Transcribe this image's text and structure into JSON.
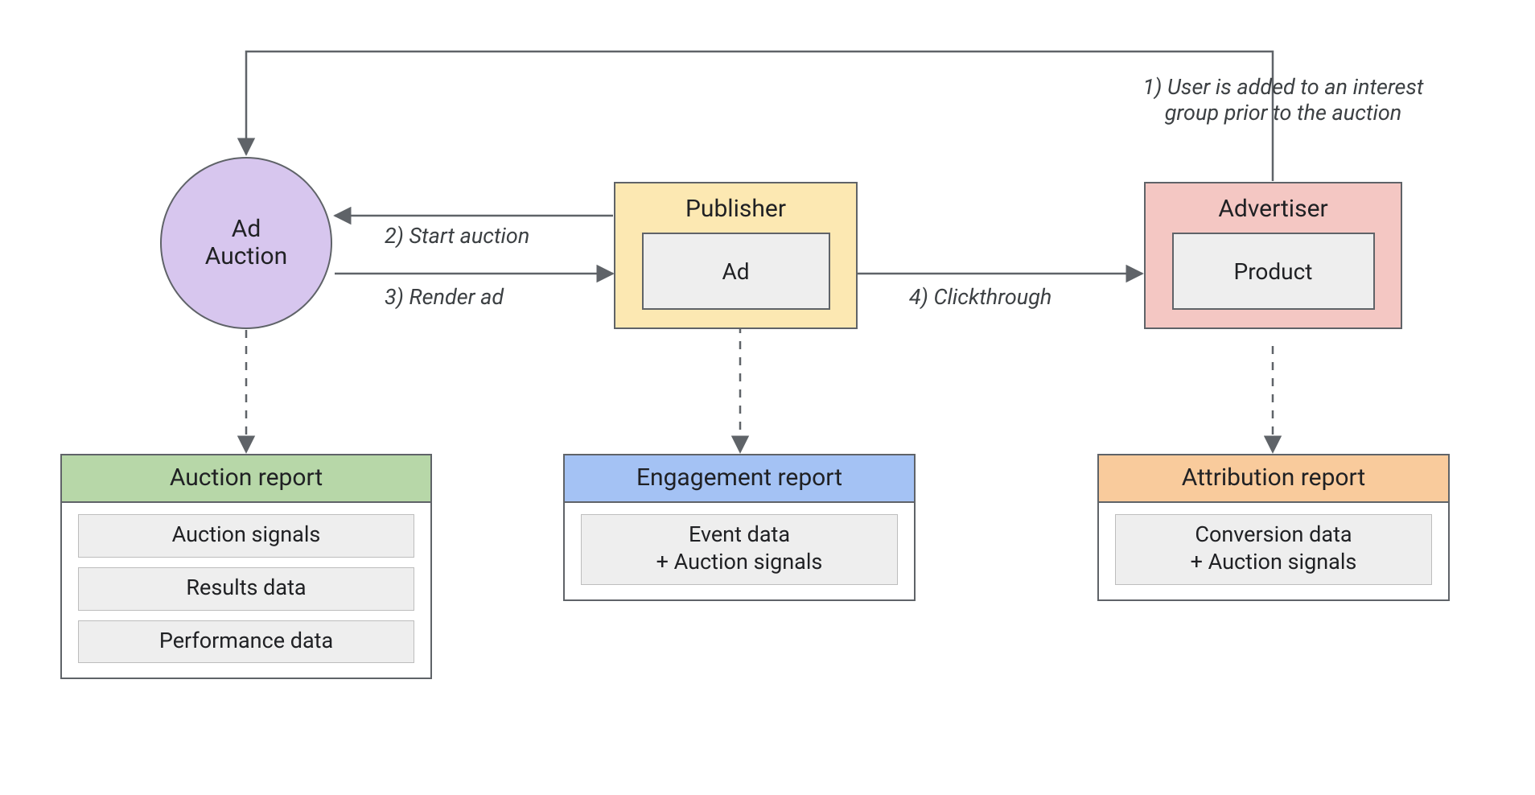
{
  "nodes": {
    "ad_auction": {
      "line1": "Ad",
      "line2": "Auction"
    },
    "publisher": {
      "title": "Publisher",
      "inner": "Ad"
    },
    "advertiser": {
      "title": "Advertiser",
      "inner": "Product"
    }
  },
  "flows": {
    "step1_line1": "1) User is added to an interest",
    "step1_line2": "group prior to the auction",
    "step2": "2) Start auction",
    "step3": "3) Render ad",
    "step4": "4) Clickthrough"
  },
  "reports": {
    "auction": {
      "title": "Auction report",
      "items": [
        "Auction signals",
        "Results data",
        "Performance data"
      ]
    },
    "engagement": {
      "title": "Engagement report",
      "items": [
        "Event data\n+ Auction signals"
      ]
    },
    "attribution": {
      "title": "Attribution report",
      "items": [
        "Conversion data\n+ Auction signals"
      ]
    }
  },
  "colors": {
    "ad_auction_fill": "#d7c6ee",
    "publisher_fill": "#fce8b2",
    "advertiser_fill": "#f4c7c3",
    "auction_header": "#b7d7a8",
    "engagement_header": "#a4c2f4",
    "attribution_header": "#f9cb9c",
    "stroke": "#5f6368"
  }
}
